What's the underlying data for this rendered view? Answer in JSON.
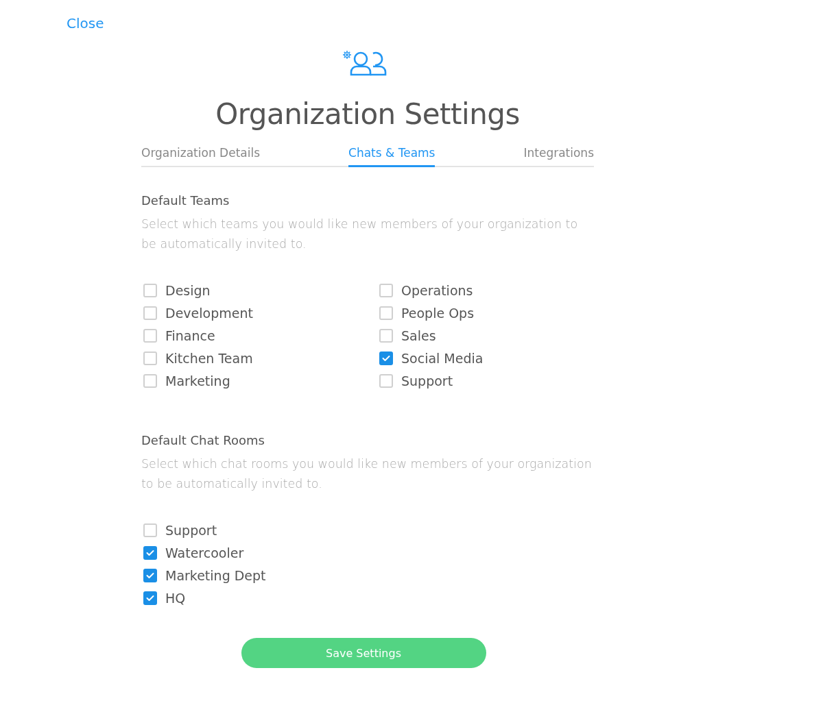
{
  "close": "Close",
  "title": "Organization Settings",
  "tabs": [
    {
      "label": "Organization Details",
      "selected": false
    },
    {
      "label": "Chats & Teams",
      "selected": true
    },
    {
      "label": "Integrations",
      "selected": false
    }
  ],
  "sections": [
    {
      "heading": "Default Teams",
      "description": "Select which teams you would like new members of your organization to be automatically invited to.",
      "kind": "two-column",
      "items": [
        {
          "label": "Design",
          "checked": false
        },
        {
          "label": "Development",
          "checked": false
        },
        {
          "label": "Finance",
          "checked": false
        },
        {
          "label": "Kitchen Team",
          "checked": false
        },
        {
          "label": "Marketing",
          "checked": false
        },
        {
          "label": "Operations",
          "checked": false
        },
        {
          "label": "People Ops",
          "checked": false
        },
        {
          "label": "Sales",
          "checked": false
        },
        {
          "label": "Social Media",
          "checked": true
        },
        {
          "label": "Support",
          "checked": false
        }
      ]
    },
    {
      "heading": "Default Chat Rooms",
      "description": "Select which chat rooms you would like new members of your organization to be automatically invited to.",
      "kind": "one-column",
      "items": [
        {
          "label": "Support",
          "checked": false
        },
        {
          "label": "Watercooler",
          "checked": true
        },
        {
          "label": "Marketing Dept",
          "checked": true
        },
        {
          "label": "HQ",
          "checked": true
        }
      ]
    }
  ],
  "save_button": "Save Settings"
}
